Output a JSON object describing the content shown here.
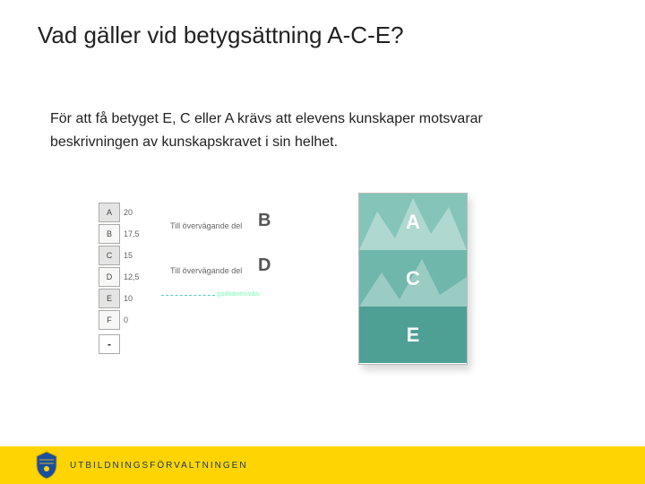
{
  "title": "Vad gäller vid betygsättning A-C-E?",
  "body_text": "För att få betyget E, C eller A krävs att elevens kunskaper motsvarar beskrivningen av kunskapskravet i sin helhet.",
  "grade_table": [
    {
      "grade": "A",
      "value": "20"
    },
    {
      "grade": "B",
      "value": "17,5"
    },
    {
      "grade": "C",
      "value": "15"
    },
    {
      "grade": "D",
      "value": "12,5"
    },
    {
      "grade": "E",
      "value": "10"
    },
    {
      "grade": "F",
      "value": "0"
    }
  ],
  "dash": "-",
  "mid": {
    "label_b": "Till övervägande del",
    "big_b": "B",
    "label_d": "Till övervägande del",
    "big_d": "D",
    "godk": "godkäntnivån"
  },
  "ace": {
    "a": "A",
    "c": "C",
    "e": "E"
  },
  "footer": {
    "org": "UTBILDNINGSFÖRVALTNINGEN"
  }
}
